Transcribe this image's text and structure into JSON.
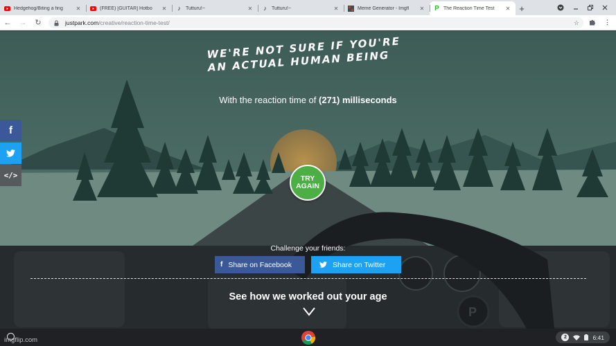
{
  "browser": {
    "tabs": [
      {
        "title": "Hedgehog/Biting a fing",
        "favicon": "youtube-icon",
        "active": false
      },
      {
        "title": "(FREE) [GUITAR] Hotbo",
        "favicon": "youtube-icon",
        "active": false
      },
      {
        "title": "Tutturu!~",
        "favicon": "music-note-icon",
        "active": false
      },
      {
        "title": "Tutturu!~",
        "favicon": "music-note-icon",
        "active": false
      },
      {
        "title": "Meme Generator - Imgfl",
        "favicon": "imgflip-icon",
        "active": false
      },
      {
        "title": "The Reaction Time Test",
        "favicon": "justpark-icon",
        "active": true
      }
    ],
    "new_tab_label": "+",
    "url_host": "justpark.com",
    "url_path": "/creative/reaction-time-test/"
  },
  "page": {
    "headline_line1": "WE'RE NOT SURE IF YOU'RE",
    "headline_line2": "AN ACTUAL HUMAN BEING",
    "subline_prefix": "With the reaction time of",
    "subline_value": "(271) milliseconds",
    "try_again_line1": "TRY",
    "try_again_line2": "AGAIN",
    "challenge_label": "Challenge your friends:",
    "share_facebook": "Share on Facebook",
    "share_twitter": "Share on Twitter",
    "see_how": "See how we worked out your age",
    "side_social": [
      "facebook-icon",
      "twitter-icon",
      "embed-code-icon"
    ]
  },
  "shelf": {
    "watermark": "imgflip.com",
    "notification_count": "2",
    "time": "6:41"
  },
  "colors": {
    "facebook": "#3b5998",
    "twitter": "#1da1f2",
    "try_again": "#4cae44"
  }
}
